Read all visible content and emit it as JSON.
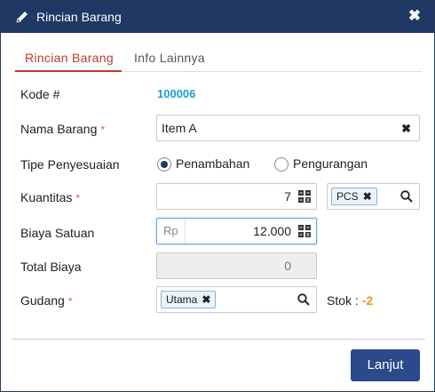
{
  "dialog": {
    "title": "Rincian Barang",
    "close_label": "✖"
  },
  "tabs": [
    {
      "label": "Rincian Barang",
      "active": true
    },
    {
      "label": "Info Lainnya",
      "active": false
    }
  ],
  "form": {
    "kode": {
      "label": "Kode #",
      "value": "100006"
    },
    "nama_barang": {
      "label": "Nama Barang",
      "required": "*",
      "value": "Item A"
    },
    "tipe_penyesuaian": {
      "label": "Tipe Penyesuaian",
      "options": [
        {
          "label": "Penambahan",
          "checked": true
        },
        {
          "label": "Pengurangan",
          "checked": false
        }
      ]
    },
    "kuantitas": {
      "label": "Kuantitas",
      "required": "*",
      "value": "7",
      "unit": "PCS"
    },
    "biaya_satuan": {
      "label": "Biaya Satuan",
      "prefix": "Rp",
      "value": "12.000"
    },
    "total_biaya": {
      "label": "Total Biaya",
      "value": "0"
    },
    "gudang": {
      "label": "Gudang",
      "required": "*",
      "value": "Utama",
      "stok_label": "Stok :",
      "stok_value": "-2"
    }
  },
  "footer": {
    "submit_label": "Lanjut"
  },
  "colors": {
    "titlebar": "#1f3864",
    "accent_tab": "#c0392b",
    "link": "#1a9ed9",
    "primary_button": "#2b4a8b",
    "stok_value": "#e39b1a"
  }
}
